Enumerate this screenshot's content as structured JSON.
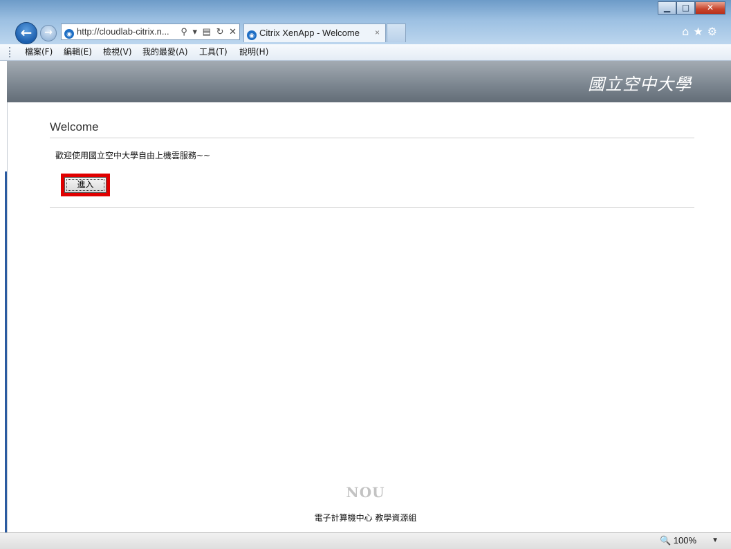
{
  "browser": {
    "address": {
      "url": "http://cloudlab-citrix.n...",
      "search_glyph": "⚲",
      "dropdown_glyph": "▾",
      "compat_glyph": "▤",
      "refresh_glyph": "↻",
      "stop_glyph": "✕"
    },
    "tab": {
      "title": "Citrix XenApp - Welcome",
      "close_glyph": "×"
    },
    "window": {
      "minimize": "▁",
      "maximize": "□",
      "close": "✕"
    },
    "command_icons": {
      "home": "⌂",
      "favorites": "★",
      "tools": "⚙"
    },
    "nav": {
      "back": "←",
      "forward": "→"
    }
  },
  "menubar": {
    "items": [
      {
        "label": "檔案(F)"
      },
      {
        "label": "編輯(E)"
      },
      {
        "label": "檢視(V)"
      },
      {
        "label": "我的最愛(A)"
      },
      {
        "label": "工具(T)"
      },
      {
        "label": "說明(H)"
      }
    ]
  },
  "header": {
    "logo_text": "國立空中大學"
  },
  "main": {
    "title": "Welcome",
    "message": "歡迎使用國立空中大學自由上機雲服務~~",
    "enter_button": "進入"
  },
  "footer": {
    "logo": "NOU",
    "org": "電子計算機中心 教學資源組"
  },
  "statusbar": {
    "zoom": "100%",
    "zoom_icon": "🔍",
    "zoom_dropdown": "▼"
  },
  "colors": {
    "highlight": "#e00000",
    "banner": "#7e8892",
    "back_button": "#1c5fae"
  }
}
